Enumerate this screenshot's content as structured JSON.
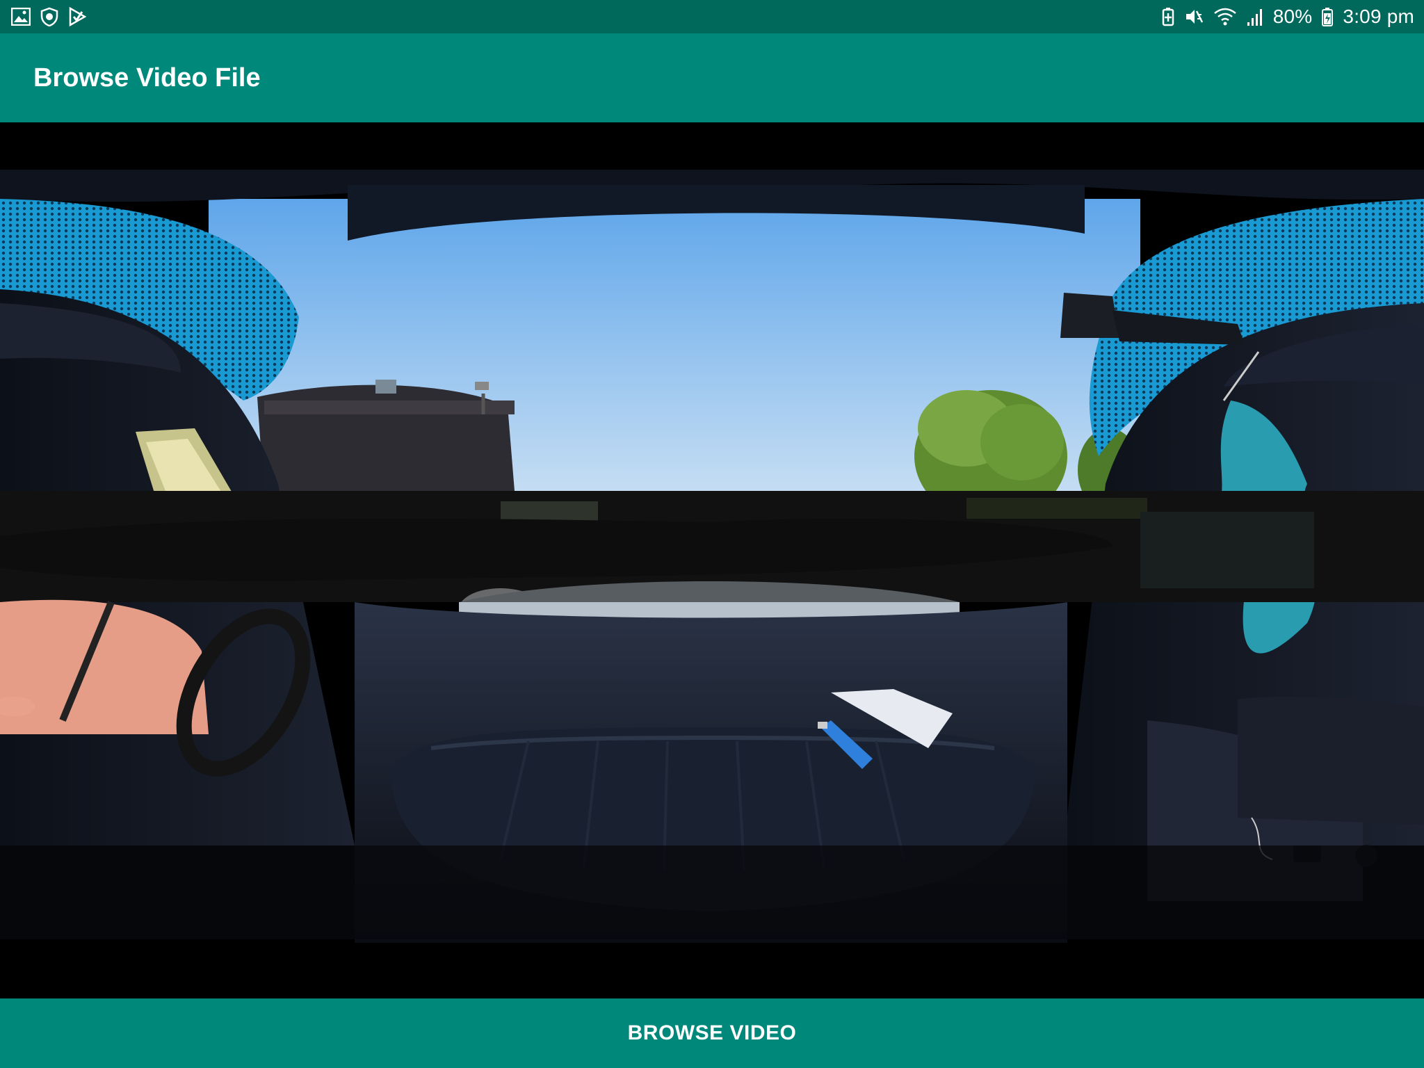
{
  "status_bar": {
    "left_icons": [
      "gallery-icon",
      "shield-icon",
      "play-store-icon"
    ],
    "right_icons": [
      "battery-saver-icon",
      "mute-icon",
      "wifi-icon",
      "signal-icon",
      "battery-icon"
    ],
    "battery_percent": "80%",
    "time": "3:09 pm"
  },
  "app_bar": {
    "title": "Browse Video File"
  },
  "video": {
    "content": "360-degree-car-interior-frame"
  },
  "bottom_bar": {
    "browse_label": "BROWSE VIDEO"
  },
  "colors": {
    "status_bar": "#00695c",
    "primary": "#00897b",
    "text": "#ffffff"
  }
}
